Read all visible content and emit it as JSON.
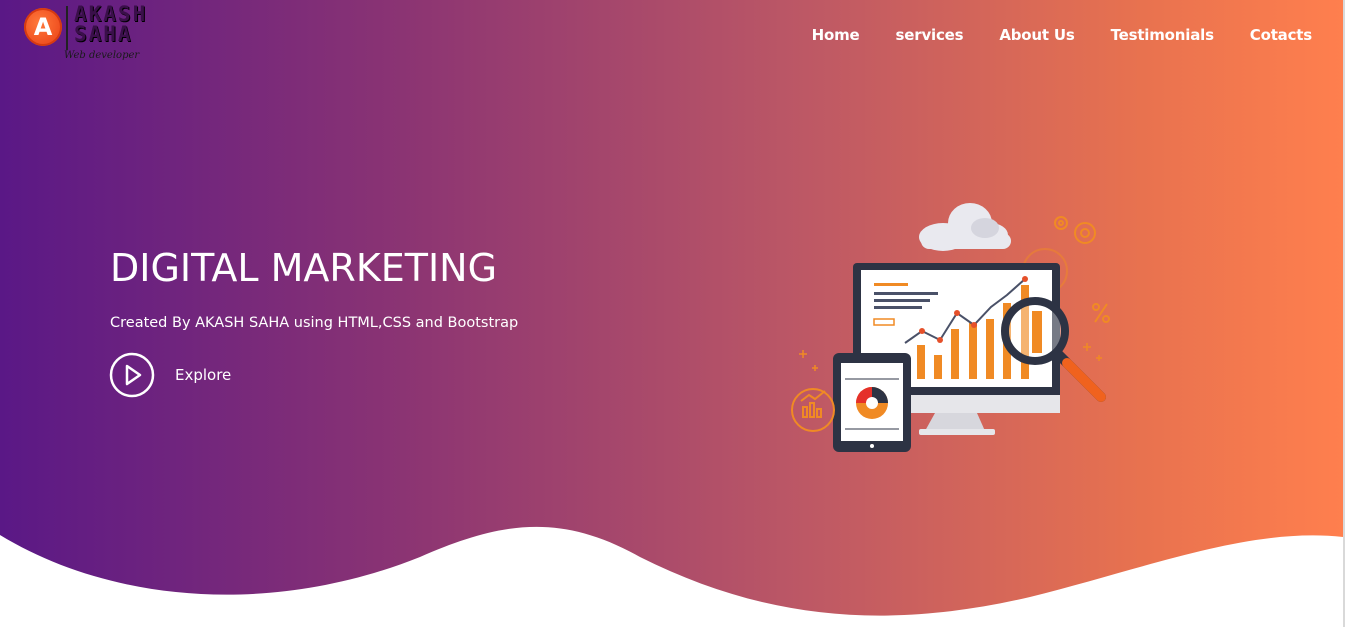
{
  "brand": {
    "logo_letter": "A",
    "name_line1": "AKASH",
    "name_line2": "SAHA",
    "tagline": "Web developer"
  },
  "nav": {
    "items": [
      "Home",
      "services",
      "About Us",
      "Testimonials",
      "Cotacts"
    ]
  },
  "hero": {
    "title": "DIGITAL MARKETING",
    "subtitle": "Created By AKASH SAHA using HTML,CSS and Bootstrap",
    "cta_label": "Explore"
  },
  "illustration": {
    "icons": [
      "cloud-icon",
      "gear-icon",
      "monitor-icon",
      "bar-chart-icon",
      "magnifier-icon",
      "tablet-icon",
      "pie-chart-icon",
      "percent-icon"
    ]
  },
  "colors": {
    "gradient_start": "#5a1886",
    "gradient_end": "#ff7f4e",
    "accent_orange": "#f08a24",
    "text": "#ffffff"
  }
}
